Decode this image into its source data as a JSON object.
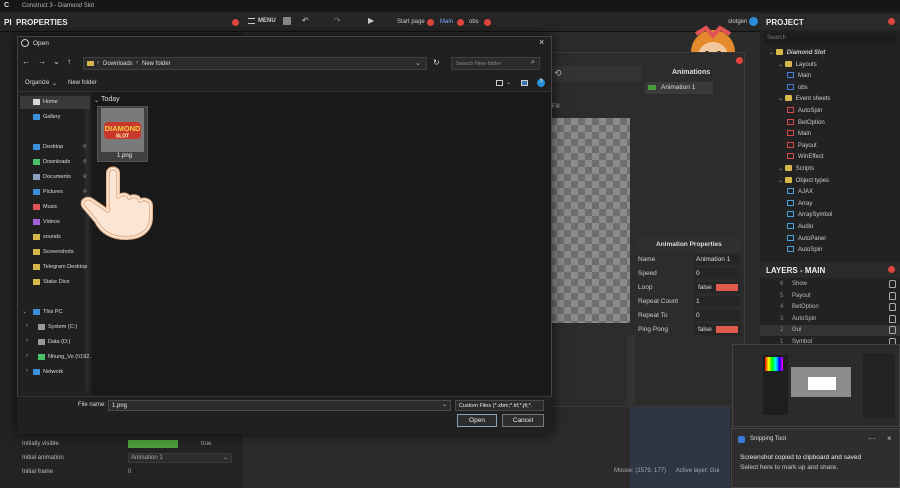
{
  "window": {
    "title": "Construct 3 - Diamond Slot"
  },
  "toolbar": {
    "menu_label": "MENU",
    "start_page": "Start page",
    "tab_main": "Main",
    "tab_obs": "obs",
    "user": "slotgen"
  },
  "properties": {
    "title": "PROPERTIES",
    "rows": [
      {
        "label": "Initially visible",
        "value": "true"
      },
      {
        "label": "Initial animation",
        "value": "Animation 1"
      },
      {
        "label": "Initial frame",
        "value": "0"
      }
    ]
  },
  "animation_editor": {
    "header": "Animations",
    "animations": [
      "Animation 1"
    ],
    "fill_label": "Fill",
    "props_title": "Animation Properties",
    "props": [
      {
        "label": "Name",
        "value": "Animation 1"
      },
      {
        "label": "Speed",
        "value": "0"
      },
      {
        "label": "Loop",
        "value": "false",
        "type": "bool"
      },
      {
        "label": "Repeat Count",
        "value": "1"
      },
      {
        "label": "Repeat To",
        "value": "0"
      },
      {
        "label": "Ping Pong",
        "value": "false",
        "type": "bool"
      }
    ]
  },
  "project": {
    "title": "PROJECT",
    "search_placeholder": "Search",
    "tree": [
      {
        "label": "Diamond Slot",
        "kind": "folder",
        "level": 1
      },
      {
        "label": "Layouts",
        "kind": "folder",
        "level": 2
      },
      {
        "label": "Main",
        "kind": "layout",
        "level": 3
      },
      {
        "label": "obs",
        "kind": "layout",
        "level": 3
      },
      {
        "label": "Event sheets",
        "kind": "folder",
        "level": 2
      },
      {
        "label": "AutoSpin",
        "kind": "sheet",
        "level": 3
      },
      {
        "label": "BetOption",
        "kind": "sheet",
        "level": 3
      },
      {
        "label": "Main",
        "kind": "sheet",
        "level": 3
      },
      {
        "label": "Payout",
        "kind": "sheet",
        "level": 3
      },
      {
        "label": "WinEffect",
        "kind": "sheet",
        "level": 3
      },
      {
        "label": "Scripts",
        "kind": "folder",
        "level": 2
      },
      {
        "label": "Object types",
        "kind": "folder",
        "level": 2
      },
      {
        "label": "AJAX",
        "kind": "obj",
        "level": 3
      },
      {
        "label": "Array",
        "kind": "obj",
        "level": 3
      },
      {
        "label": "ArraySymbol",
        "kind": "obj",
        "level": 3
      },
      {
        "label": "Audio",
        "kind": "obj",
        "level": 3
      },
      {
        "label": "AutoPanel",
        "kind": "obj",
        "level": 3
      },
      {
        "label": "AutoSpin",
        "kind": "obj",
        "level": 3
      }
    ]
  },
  "layers": {
    "title": "LAYERS - MAIN",
    "items": [
      {
        "num": "6",
        "name": "Show"
      },
      {
        "num": "5",
        "name": "Payout"
      },
      {
        "num": "4",
        "name": "BetOption"
      },
      {
        "num": "3",
        "name": "AutoSpin"
      },
      {
        "num": "2",
        "name": "Gui"
      },
      {
        "num": "1",
        "name": "Symbol"
      }
    ]
  },
  "status": {
    "mouse": "Mouse: (1579, 177)",
    "active_layer": "Active layer: Gui"
  },
  "dialog": {
    "title": "Open",
    "breadcrumb": [
      "Downloads",
      "New folder"
    ],
    "search_placeholder": "Search New folder",
    "organize_label": "Organize",
    "new_folder_label": "New folder",
    "sidebar": [
      {
        "label": "Home",
        "icon": "home-icon",
        "selected": true
      },
      {
        "label": "Gallery",
        "icon": "gallery-icon"
      },
      {
        "label": "Desktop",
        "icon": "desktop-icon",
        "pinned": true
      },
      {
        "label": "Downloads",
        "icon": "download-icon",
        "pinned": true
      },
      {
        "label": "Documents",
        "icon": "documents-icon",
        "pinned": true
      },
      {
        "label": "Pictures",
        "icon": "pictures-icon",
        "pinned": true
      },
      {
        "label": "Music",
        "icon": "music-icon"
      },
      {
        "label": "Videos",
        "icon": "videos-icon"
      },
      {
        "label": "sounds",
        "icon": "folder-icon"
      },
      {
        "label": "Screenshots",
        "icon": "folder-icon"
      },
      {
        "label": "Telegram Desktop",
        "icon": "folder-icon"
      },
      {
        "label": "Stake Dice",
        "icon": "folder-icon"
      },
      {
        "label": "This PC",
        "icon": "pc-icon"
      },
      {
        "label": "System (C:)",
        "icon": "drive-icon"
      },
      {
        "label": "Data (D:)",
        "icon": "drive-icon"
      },
      {
        "label": "Nhung_Vo (\\\\192.",
        "icon": "network-drive-icon"
      },
      {
        "label": "Network",
        "icon": "network-icon"
      }
    ],
    "group_label": "Today",
    "files": [
      {
        "name": "1.png",
        "thumb_text_top": "DIAMOND",
        "thumb_text_bottom": "SLOT"
      }
    ],
    "file_name_label": "File name:",
    "file_name_value": "1.png",
    "filter_value": "Custom Files (*.xbm;*.tif;*.jfi;*.",
    "open_label": "Open",
    "cancel_label": "Cancel"
  },
  "toast": {
    "app": "Snipping Tool",
    "line1": "Screenshot copied to clipboard and saved",
    "line2": "Select here to mark up and share."
  }
}
